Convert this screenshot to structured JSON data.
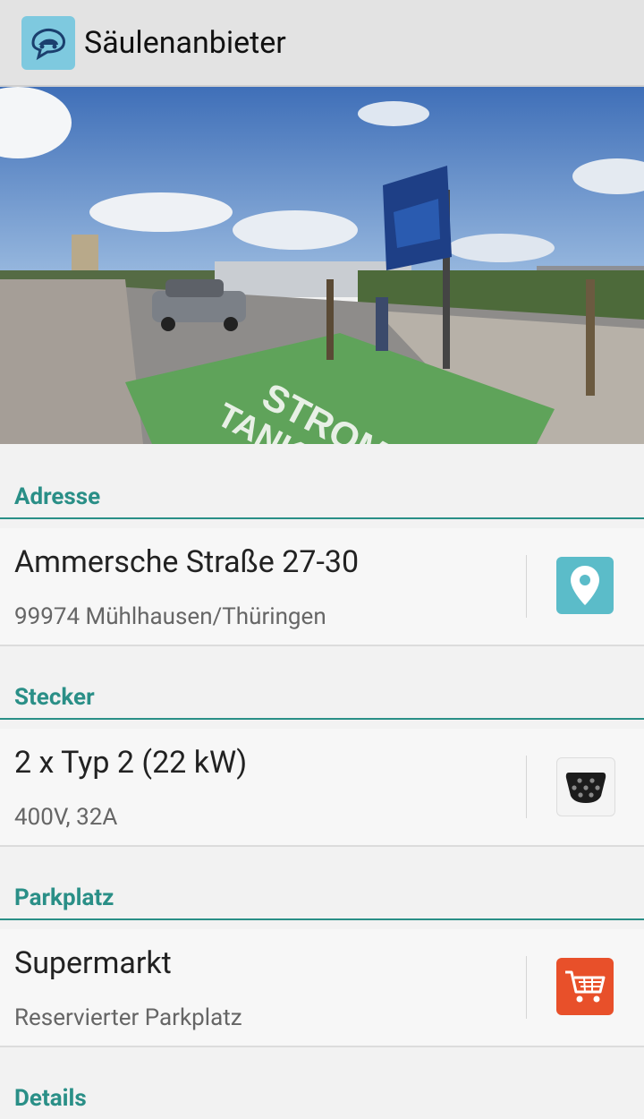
{
  "appbar": {
    "title": "Säulenanbieter",
    "icon": "car-speech-bubble-icon"
  },
  "photo": {
    "scene": "photo-charging-station-parking",
    "painted_text": [
      "STROM",
      "TANKSTELLE"
    ]
  },
  "sections": {
    "adresse": {
      "header": "Adresse",
      "primary": "Ammersche Straße 27-30",
      "secondary": "99974 Mühlhausen/Thüringen",
      "icon": "map-pin-icon",
      "icon_color": "#5bbcc9"
    },
    "stecker": {
      "header": "Stecker",
      "primary": "2 x Typ 2 (22 kW)",
      "secondary": "400V, 32A",
      "icon": "type2-plug-icon",
      "icon_color": "#222222"
    },
    "parkplatz": {
      "header": "Parkplatz",
      "primary": "Supermarkt",
      "secondary": "Reservierter Parkplatz",
      "icon": "shopping-cart-icon",
      "icon_color": "#e8502a"
    },
    "details": {
      "header": "Details"
    }
  },
  "colors": {
    "accent": "#2a8f87",
    "appbar_bg": "#e3e3e3",
    "card_bg": "#f7f7f7",
    "page_bg": "#f2f2f2"
  }
}
